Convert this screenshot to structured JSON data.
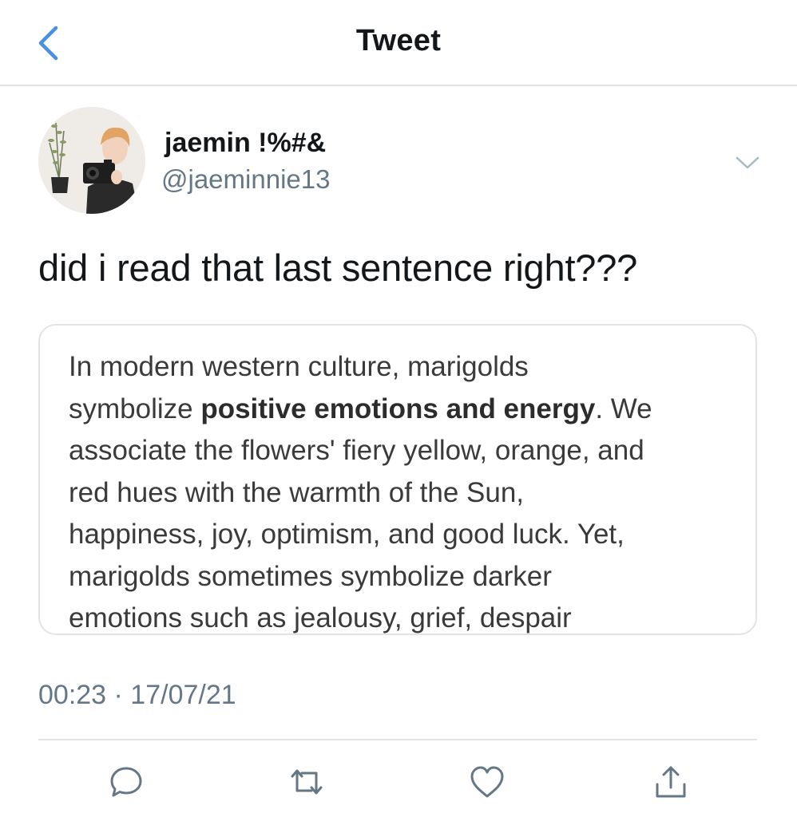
{
  "nav": {
    "title": "Tweet",
    "back_icon": "chevron-left-icon"
  },
  "author": {
    "display_name": "jaemin !%#&",
    "handle": "@jaeminnie13",
    "avatar_icon": "profile-photo"
  },
  "tweet": {
    "text": "did i read that last sentence right???",
    "timestamp": "00:23 · 17/07/21"
  },
  "quote": {
    "line1": "In modern western culture, marigolds",
    "line2_pre": "symbolize ",
    "line2_bold": "positive emotions and energy",
    "line2_post": ". We",
    "line3": "associate the flowers' fiery yellow, orange, and",
    "line4": "red hues with the warmth of the Sun,",
    "line5": "happiness, joy, optimism, and good luck. Yet,",
    "line6": "marigolds sometimes symbolize darker",
    "line7": "emotions such as jealousy, grief, despair"
  },
  "actions": [
    "reply-icon",
    "retweet-icon",
    "like-icon",
    "share-icon"
  ],
  "colors": {
    "accent": "#4a90e2",
    "secondary_text": "#657786",
    "border": "#e1e4e6"
  }
}
